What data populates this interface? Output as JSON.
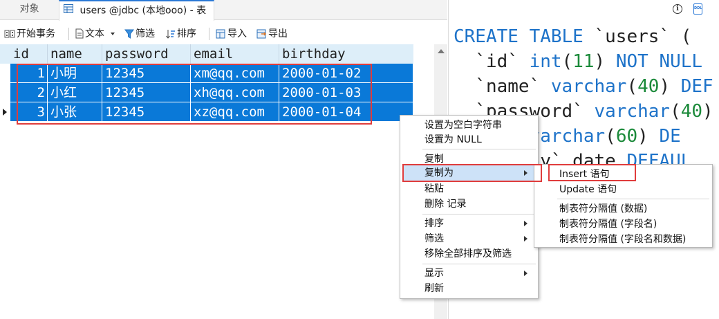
{
  "tabs": [
    {
      "label": "对象"
    },
    {
      "label": "users @jdbc (本地ooo) - 表"
    }
  ],
  "toolbar": {
    "begin_transaction": "开始事务",
    "text": "文本",
    "filter": "筛选",
    "sort": "排序",
    "import": "导入",
    "export": "导出"
  },
  "grid": {
    "columns": [
      "id",
      "name",
      "password",
      "email",
      "birthday"
    ],
    "rows": [
      {
        "id": "1",
        "name": "小明",
        "password": "12345",
        "email": "xm@qq.com",
        "birthday": "2000-01-02"
      },
      {
        "id": "2",
        "name": "小红",
        "password": "12345",
        "email": "xh@qq.com",
        "birthday": "2000-01-03"
      },
      {
        "id": "3",
        "name": "小张",
        "password": "12345",
        "email": "xz@qq.com",
        "birthday": "2000-01-04"
      }
    ],
    "selection_color": "#0a79d8"
  },
  "ddl": {
    "line1_a": "CREATE TABLE",
    "line1_b": " `users` (",
    "line2_a": "  `id` ",
    "line2_b": "int",
    "line2_c": "(",
    "line2_d": "11",
    "line2_e": ") ",
    "line2_f": "NOT NULL",
    "line3_a": "  `name` ",
    "line3_b": "varchar",
    "line3_c": "(",
    "line3_d": "40",
    "line3_e": ") ",
    "line3_f": "DEF",
    "line4_a": "  `password` ",
    "line4_b": "varchar",
    "line4_c": "(",
    "line4_d": "40",
    "line4_e": ")",
    "line5_a": "     ` ",
    "line5_b": "varchar",
    "line5_c": "(",
    "line5_d": "60",
    "line5_e": ") ",
    "line5_f": "DE",
    "line6_a": "      day` date ",
    "line6_b": "DEFAUL"
  },
  "context_menu": {
    "items": [
      {
        "label": "设置为空白字符串"
      },
      {
        "label": "设置为 NULL"
      },
      {
        "label": "复制"
      },
      {
        "label": "复制为"
      },
      {
        "label": "粘贴"
      },
      {
        "label": "删除 记录"
      },
      {
        "label": "排序"
      },
      {
        "label": "筛选"
      },
      {
        "label": "移除全部排序及筛选"
      },
      {
        "label": "显示"
      },
      {
        "label": "刷新"
      }
    ]
  },
  "copy_as_submenu": {
    "items": [
      {
        "label": "Insert 语句"
      },
      {
        "label": "Update 语句"
      },
      {
        "label": "制表符分隔值 (数据)"
      },
      {
        "label": "制表符分隔值 (字段名)"
      },
      {
        "label": "制表符分隔值 (字段名和数据)"
      }
    ]
  },
  "colors": {
    "accent": "#0a79d8",
    "highlight_box": "#e03c3c",
    "keyword": "#1e73c9",
    "number": "#1b8a3a"
  }
}
